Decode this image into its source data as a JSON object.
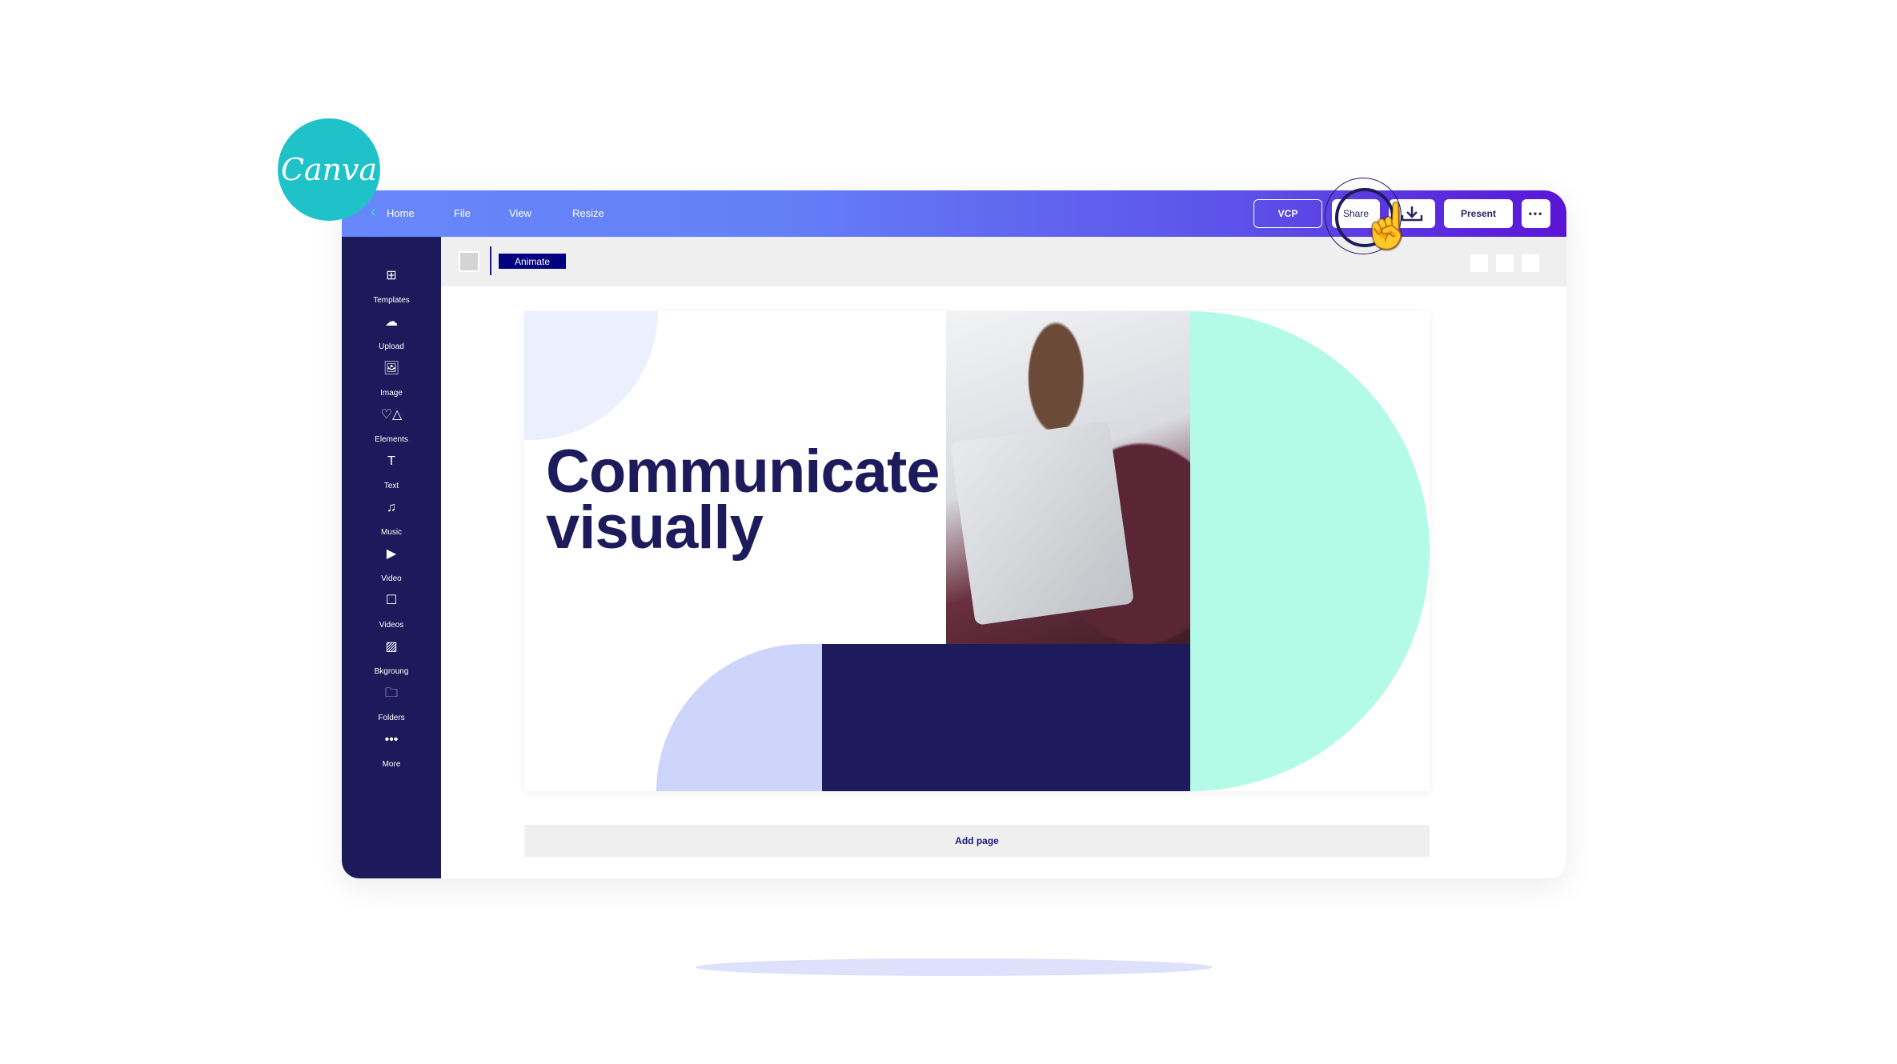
{
  "brand": {
    "logo_text": "Canva",
    "color": "#1fc2c8"
  },
  "topbar": {
    "home": "Home",
    "menu": [
      "File",
      "View",
      "Resize"
    ],
    "team": "VCP",
    "share": "Share",
    "present": "Present",
    "more": "•••"
  },
  "toolbar": {
    "animate": "Animate"
  },
  "sidebar": {
    "items": [
      {
        "label": "Templates",
        "icon": "⊞"
      },
      {
        "label": "Upload",
        "icon": "☁"
      },
      {
        "label": "Image",
        "icon": "🖼"
      },
      {
        "label": "Elements",
        "icon": "♡△"
      },
      {
        "label": "Text",
        "icon": "T"
      },
      {
        "label": "Music",
        "icon": "♫"
      },
      {
        "label": "Video",
        "icon": "▶"
      },
      {
        "label": "Videos",
        "icon": "☐"
      },
      {
        "label": "Bkgroung",
        "icon": "▨"
      },
      {
        "label": "Folders",
        "icon": "🗀"
      },
      {
        "label": "More",
        "icon": "•••"
      }
    ]
  },
  "design": {
    "line1": "Communicate",
    "line2": "visually"
  },
  "add_page": "Add page",
  "colors": {
    "navy": "#1e1b5c",
    "mint": "#b3fbe6",
    "lavender": "#cdd5fb",
    "accent": "#5a14d6"
  }
}
